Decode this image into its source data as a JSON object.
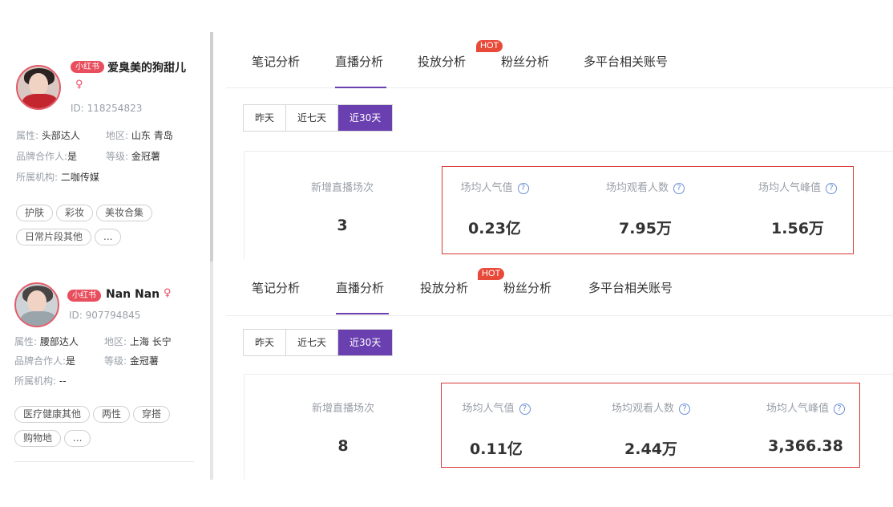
{
  "profiles": [
    {
      "platform_badge": "小红书",
      "name": "爱臭美的狗甜儿",
      "id": "ID: 118254823",
      "type_label": "属性:",
      "type_value": "头部达人",
      "region_label": "地区:",
      "region_value": "山东 青岛",
      "brand_label": "品牌合作人:",
      "brand_value": "是",
      "level_label": "等级:",
      "level_value": "金冠薯",
      "org_label": "所属机构:",
      "org_value": "二咖传媒",
      "tags": [
        "护肤",
        "彩妆",
        "美妆合集",
        "日常片段其他",
        "..."
      ]
    },
    {
      "platform_badge": "小红书",
      "name": "Nan Nan",
      "id": "ID: 907794845",
      "type_label": "属性:",
      "type_value": "腰部达人",
      "region_label": "地区:",
      "region_value": "上海 长宁",
      "brand_label": "品牌合作人:",
      "brand_value": "是",
      "level_label": "等级:",
      "level_value": "金冠薯",
      "org_label": "所属机构:",
      "org_value": "--",
      "tags": [
        "医疗健康其他",
        "两性",
        "穿搭",
        "购物地",
        "..."
      ]
    }
  ],
  "tabs": [
    "笔记分析",
    "直播分析",
    "投放分析",
    "粉丝分析",
    "多平台相关账号"
  ],
  "active_tab": "直播分析",
  "hot_badge": "HOT",
  "range_options": [
    "昨天",
    "近七天",
    "近30天"
  ],
  "active_range": "近30天",
  "metric_labels": [
    "新增直播场次",
    "场均人气值",
    "场均观看人数",
    "场均人气峰值"
  ],
  "help_icon": "?",
  "panels": [
    {
      "values": [
        "3",
        "0.23亿",
        "7.95万",
        "1.56万"
      ]
    },
    {
      "values": [
        "8",
        "0.11亿",
        "2.44万",
        "3,366.38"
      ]
    }
  ],
  "colors": {
    "accent": "#6a3fb0",
    "badge": "#e84e5d",
    "hot": "#e84a3a",
    "highlight_box": "#d93636"
  }
}
